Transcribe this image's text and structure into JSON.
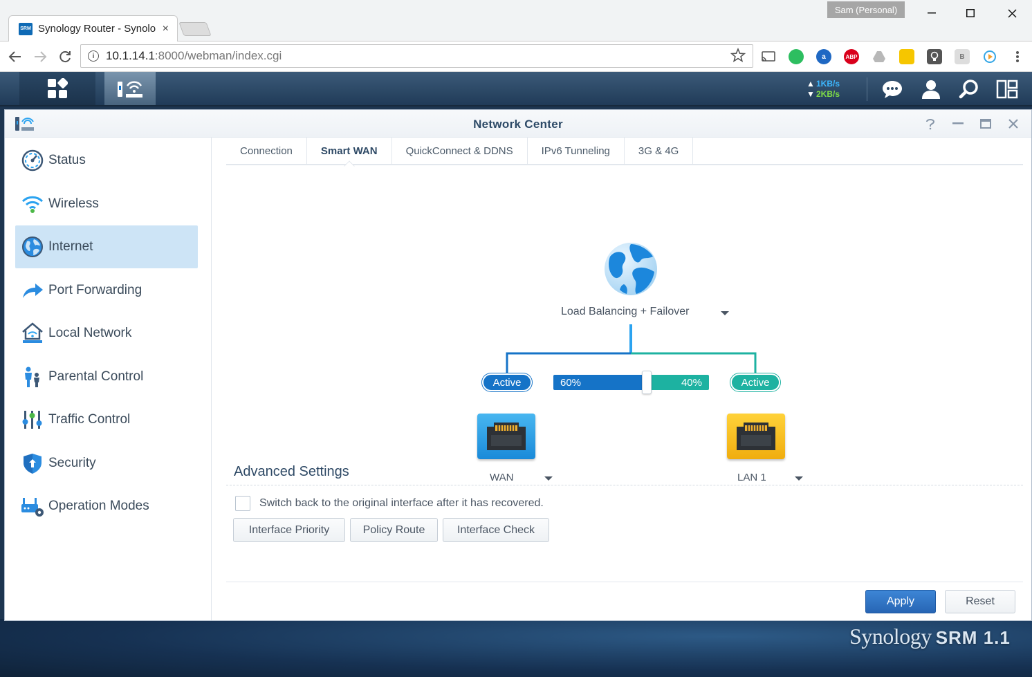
{
  "browser": {
    "tab_title": "Synology Router - Synolo",
    "tab_favicon_text": "SRM",
    "close_glyph": "×",
    "profile": "Sam (Personal)",
    "url_host": "10.1.14.1",
    "url_rest": ":8000/webman/index.cgi",
    "info_glyph": "i",
    "extensions": [
      "cast-icon",
      "evernote-icon",
      "amazon-icon",
      "adblock-icon",
      "drive-icon",
      "notes-icon",
      "lightbulb-icon",
      "readability-icon",
      "play-icon"
    ]
  },
  "srm_bar": {
    "upload_speed": "1KB/s",
    "download_speed": "2KB/s"
  },
  "window": {
    "title": "Network Center"
  },
  "sidebar": {
    "items": [
      {
        "label": "Status"
      },
      {
        "label": "Wireless"
      },
      {
        "label": "Internet"
      },
      {
        "label": "Port Forwarding"
      },
      {
        "label": "Local Network"
      },
      {
        "label": "Parental Control"
      },
      {
        "label": "Traffic Control"
      },
      {
        "label": "Security"
      },
      {
        "label": "Operation Modes"
      }
    ],
    "active_index": 2
  },
  "tabs": [
    {
      "label": "Connection"
    },
    {
      "label": "Smart WAN"
    },
    {
      "label": "QuickConnect & DDNS"
    },
    {
      "label": "IPv6 Tunneling"
    },
    {
      "label": "3G & 4G"
    }
  ],
  "active_tab": 1,
  "smart_wan": {
    "mode": "Load Balancing + Failover",
    "wan_status": "Active",
    "lan_status": "Active",
    "wan_ratio": "60%",
    "lan_ratio": "40%",
    "wan_ratio_value": 0.6,
    "wan_interface": "WAN",
    "lan_interface": "LAN 1"
  },
  "advanced": {
    "title": "Advanced Settings",
    "switch_back_label": "Switch back to the original interface after it has recovered.",
    "switch_back_checked": false,
    "buttons": {
      "interface_priority": "Interface Priority",
      "policy_route": "Policy Route",
      "interface_check": "Interface Check"
    }
  },
  "footer": {
    "apply": "Apply",
    "reset": "Reset"
  },
  "desktop": {
    "brand": "Synology",
    "product": "SRM 1.1"
  },
  "colors": {
    "accent_blue": "#1573c7",
    "accent_teal": "#1db2a1",
    "active_nav": "#cde4f6"
  }
}
